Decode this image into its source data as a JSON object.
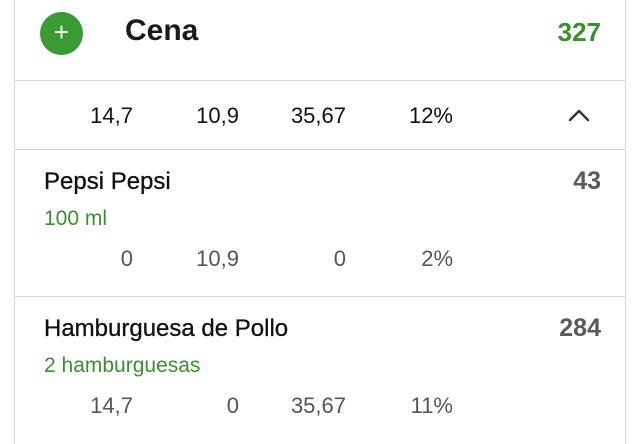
{
  "meal": {
    "title": "Cena",
    "kcal": "327",
    "add_icon_glyph": "+",
    "totals": {
      "protein": "14,7",
      "carbs": "10,9",
      "fat": "35,67",
      "percent": "12%"
    }
  },
  "icons": {
    "add": "plus-icon",
    "collapse": "chevron-up-icon"
  },
  "colors": {
    "accent_green": "#3a9b35",
    "kcal_green": "#3a8f2f",
    "item_kcal_gray": "#5a5a5a"
  },
  "items": [
    {
      "name": "Pepsi Pepsi",
      "quantity": "100 ml",
      "kcal": "43",
      "protein": "0",
      "carbs": "10,9",
      "fat": "0",
      "percent": "2%"
    },
    {
      "name": "Hamburguesa de Pollo",
      "quantity": "2 hamburguesas",
      "kcal": "284",
      "protein": "14,7",
      "carbs": "0",
      "fat": "35,67",
      "percent": "11%"
    }
  ]
}
